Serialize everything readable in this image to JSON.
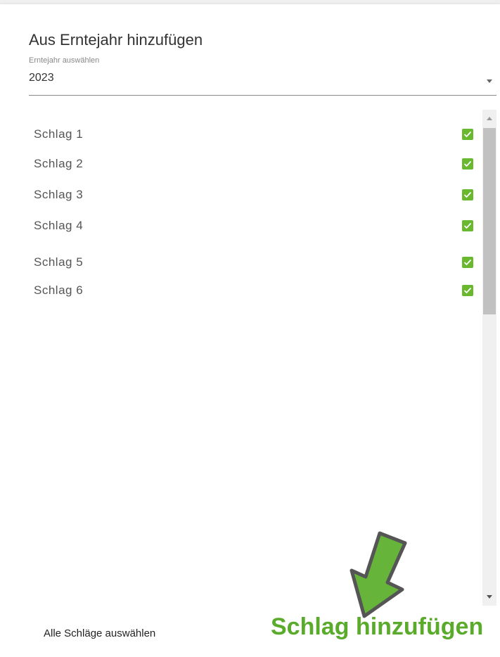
{
  "dialog": {
    "title": "Aus Erntejahr hinzufügen",
    "select": {
      "label": "Erntejahr auswählen",
      "value": "2023"
    }
  },
  "plots": [
    {
      "label": "Schlag 1",
      "checked": true
    },
    {
      "label": "Schlag 2",
      "checked": true
    },
    {
      "label": "Schlag 3",
      "checked": true
    },
    {
      "label": "Schlag 4",
      "checked": true
    },
    {
      "label": "Schlag 5",
      "checked": true
    },
    {
      "label": "Schlag 6",
      "checked": true
    }
  ],
  "footer": {
    "select_all_label": "Alle Schläge auswählen",
    "add_label": "Schlag hinzufügen"
  },
  "colors": {
    "accent_green": "#5aab2c",
    "checkbox_green": "#6ab82e",
    "arrow_green": "#66b53a",
    "arrow_outline": "#555555"
  },
  "icons": {
    "checkbox": "check-icon",
    "dropdown": "caret-down-icon",
    "annotation": "arrow-down-icon"
  }
}
